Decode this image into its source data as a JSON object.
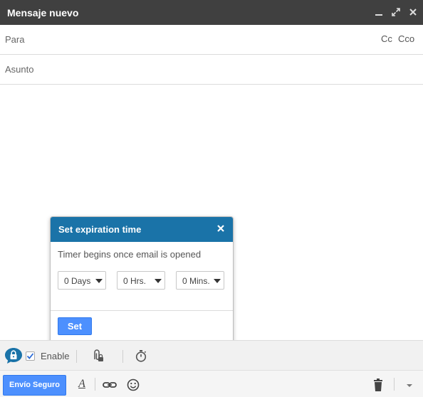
{
  "window": {
    "title": "Mensaje nuevo",
    "minimize_icon": "minimize-icon",
    "expand_icon": "expand-icon",
    "close_icon": "close-icon"
  },
  "fields": {
    "to_label": "Para",
    "cc_label": "Cc",
    "bcc_label": "Cco",
    "subject_label": "Asunto"
  },
  "popup": {
    "title": "Set expiration time",
    "description": "Timer begins once email is opened",
    "days_value": "0 Days",
    "hours_value": "0 Hrs.",
    "minutes_value": "0 Mins.",
    "set_label": "Set",
    "header_color": "#1a73a8"
  },
  "secure_bar": {
    "enabled": true,
    "enable_label": "Enable",
    "lock_icon": "lock-icon",
    "attach_lock_icon": "attach-lock-icon",
    "timer_icon": "timer-icon"
  },
  "toolbar": {
    "send_label": "Envío Seguro",
    "font_icon": "font-format-icon",
    "link_icon": "link-icon",
    "emoji_icon": "emoji-icon",
    "trash_icon": "trash-icon",
    "more_icon": "chevron-down-icon",
    "accent_color": "#4d90fe"
  }
}
